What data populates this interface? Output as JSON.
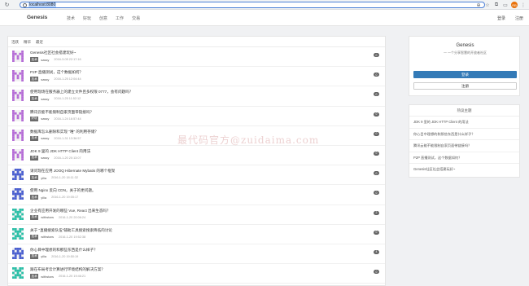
{
  "browser": {
    "url": "localhost:8080",
    "profile_initials": "RB"
  },
  "site": {
    "logo": "Genesis",
    "nav": [
      "技术",
      "好玩",
      "创意",
      "工作",
      "交易"
    ],
    "login_link": "登录",
    "register_link": "注册"
  },
  "tabs": [
    "活跃",
    "精华",
    "最近"
  ],
  "topics": [
    {
      "title": "Genesis社区社会搭建玩好~",
      "tag": "技术",
      "author": "sassy",
      "time": "2016-3-05 22:17:16",
      "count": "0",
      "avatar": "M"
    },
    {
      "title": "P2P 直播测试，这个数据如何？",
      "tag": "技术",
      "author": "sassy",
      "time": "2016-1-25 12:04:44",
      "count": "0",
      "avatar": "M"
    },
    {
      "title": "使用现场在服务器上的建立文件且多权限 0777，会有问题吗？",
      "tag": "技术",
      "author": "sassy",
      "time": "2016-1-25 11:52:12",
      "count": "0",
      "avatar": "M"
    },
    {
      "title": "腾讯云能不能限制自家页面带链接吗？",
      "tag": "好玩",
      "author": "sassy",
      "time": "2016-1-24 16:57:44",
      "count": "0",
      "avatar": "M"
    },
    {
      "title": "数据库怎么删除和实现 \"唯\" 的利用存储？",
      "tag": "技术",
      "author": "sassy",
      "time": "2016-1-31 13:36:57",
      "count": "0",
      "avatar": "M"
    },
    {
      "title": "JDK 9 里的 JDK HTTP Client 的用法",
      "tag": "技术",
      "author": "sassy",
      "time": "2016-1-20 20:13:07",
      "count": "0",
      "avatar": "M"
    },
    {
      "title": "请问现在应用 JOOQ Hibernate Mybatis 的哪个框架",
      "tag": "技术",
      "author": "yilia",
      "time": "2016-1-20 18:11:32",
      "count": "0",
      "avatar": "P"
    },
    {
      "title": "使用 Nginx 反向 CDN，关于的更问题。",
      "tag": "技术",
      "author": "yilia",
      "time": "2016-1-20 19:05:17",
      "count": "0",
      "avatar": "P"
    },
    {
      "title": "企业有应用开发的哪些 Vue, React 出来生态吗？",
      "tag": "技术",
      "author": "withstars",
      "time": "2016-1-20 20:06:24",
      "count": "2",
      "avatar": "T"
    },
    {
      "title": "关于 \"直播搜索队伍\"辅助工具搜索搜索降低的讨论",
      "tag": "技术",
      "author": "withstars",
      "time": "2016-1-20 19:52:38",
      "count": "0",
      "avatar": "T"
    },
    {
      "title": "你心目中理想的和那些东西是什么样子？",
      "tag": "技术",
      "author": "yilia",
      "time": "2016-1-20 19:50:19",
      "count": "4",
      "avatar": "P"
    },
    {
      "title": "跟在布局考云计算进行环境结构的解决方案？",
      "tag": "技术",
      "author": "withstars",
      "time": "2016-1-20 19:46:21",
      "count": "0",
      "avatar": "T"
    }
  ],
  "sidebar": {
    "title": "Genesis",
    "subtitle": "一 一个分享智慧的开放者社区",
    "login_button": "登录",
    "register_button": "注册",
    "hot_header": "热议主题",
    "hot_topics": [
      "JDK 9 里的 JDK HTTP Client 的用法",
      "你心目中理想的和那些东西是什么样子？",
      "腾讯云能不能限制自家页面带链接吗？",
      "P2P 直播测试，这个数据如何？",
      "Genesis社区社会搭建玩好~"
    ]
  },
  "watermark": "最代码官方@zuidaima.com",
  "colors": {
    "accent": "#337ab7",
    "avatar_purple": "#b56cd6",
    "avatar_blue": "#4a5fcf",
    "avatar_teal": "#2bbfa7",
    "tag_bg": "#6b6b6b"
  }
}
